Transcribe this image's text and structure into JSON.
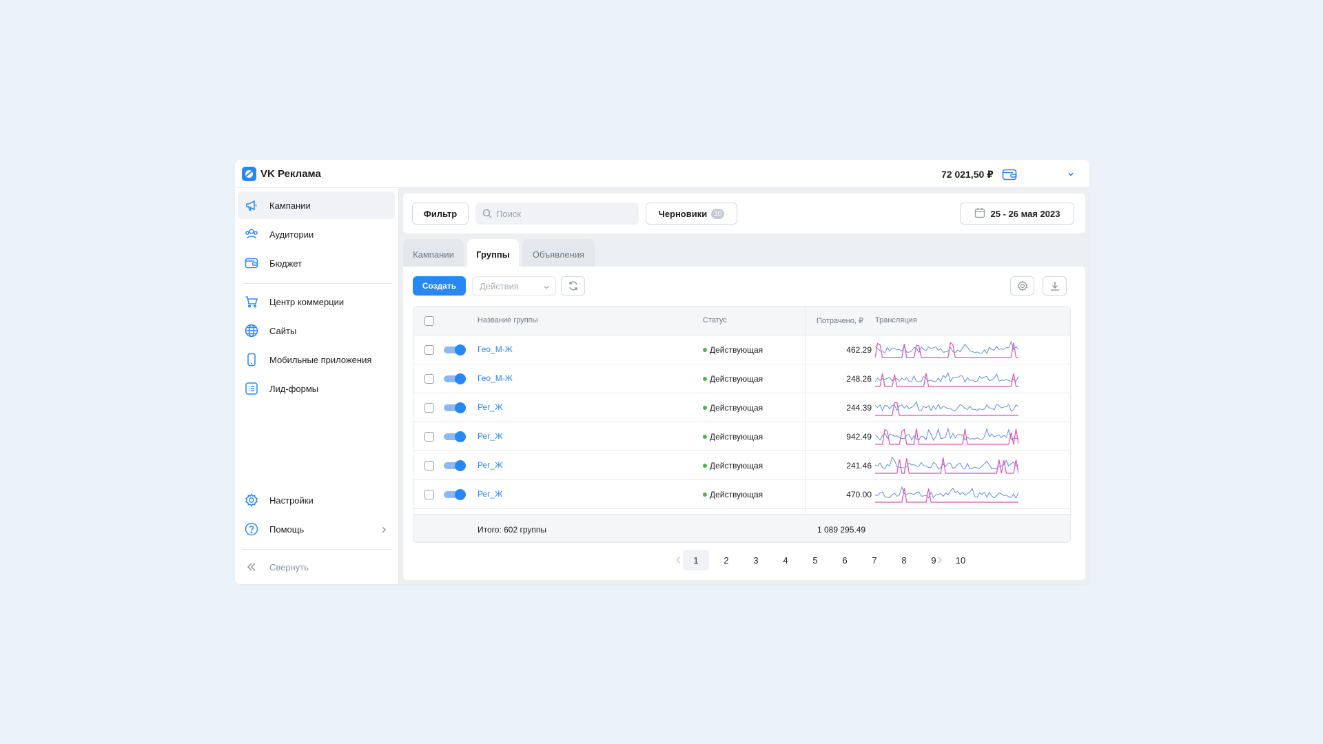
{
  "app": {
    "brand": "VK Реклама",
    "balance": "72 021,50 ₽"
  },
  "sidebar": {
    "items": [
      {
        "label": "Кампании",
        "icon": "megaphone-icon"
      },
      {
        "label": "Аудитории",
        "icon": "users-icon"
      },
      {
        "label": "Бюджет",
        "icon": "wallet-icon"
      },
      {
        "label": "Центр коммерции",
        "icon": "cart-icon"
      },
      {
        "label": "Сайты",
        "icon": "globe-icon"
      },
      {
        "label": "Мобильные приложения",
        "icon": "smartphone-icon"
      },
      {
        "label": "Лид-формы",
        "icon": "form-list-icon"
      },
      {
        "label": "Настройки",
        "icon": "gear-icon"
      },
      {
        "label": "Помощь",
        "icon": "help-icon"
      }
    ],
    "collapse_label": "Свернуть"
  },
  "filterbar": {
    "filter_label": "Фильтр",
    "search_placeholder": "Поиск",
    "drafts_label": "Черновики",
    "drafts_count": "10",
    "date_range": "25 - 26 мая 2023"
  },
  "tabs": [
    {
      "label": "Кампании",
      "active": false
    },
    {
      "label": "Группы",
      "active": true
    },
    {
      "label": "Объявления",
      "active": false
    }
  ],
  "toolbar": {
    "create_label": "Создать",
    "actions_placeholder": "Действия"
  },
  "table": {
    "headers": {
      "name": "Название группы",
      "status": "Статус",
      "spent": "Потрачено, ₽",
      "broadcast": "Трансляция"
    },
    "rows": [
      {
        "name": "Гео_М-Ж",
        "status": "Действующая",
        "spent": "462.29",
        "enabled": true
      },
      {
        "name": "Гео_М-Ж",
        "status": "Действующая",
        "spent": "248.26",
        "enabled": true
      },
      {
        "name": "Рег_Ж",
        "status": "Действующая",
        "spent": "244.39",
        "enabled": true
      },
      {
        "name": "Рег_Ж",
        "status": "Действующая",
        "spent": "942.49",
        "enabled": true
      },
      {
        "name": "Рег_Ж",
        "status": "Действующая",
        "spent": "241.46",
        "enabled": true
      },
      {
        "name": "Рег_Ж",
        "status": "Действующая",
        "spent": "470.00",
        "enabled": true
      }
    ],
    "footer": {
      "total_label": "Итого: 602 группы",
      "total_spent": "1 089 295.49"
    }
  },
  "pagination": {
    "pages": [
      "1",
      "2",
      "3",
      "4",
      "5",
      "6",
      "7",
      "8",
      "9",
      "10"
    ],
    "current": "1"
  },
  "colors": {
    "accent": "#2787f5",
    "status_active": "#4bb34b",
    "spark_blue": "#5b8fe6",
    "spark_pink": "#e04fb3"
  }
}
